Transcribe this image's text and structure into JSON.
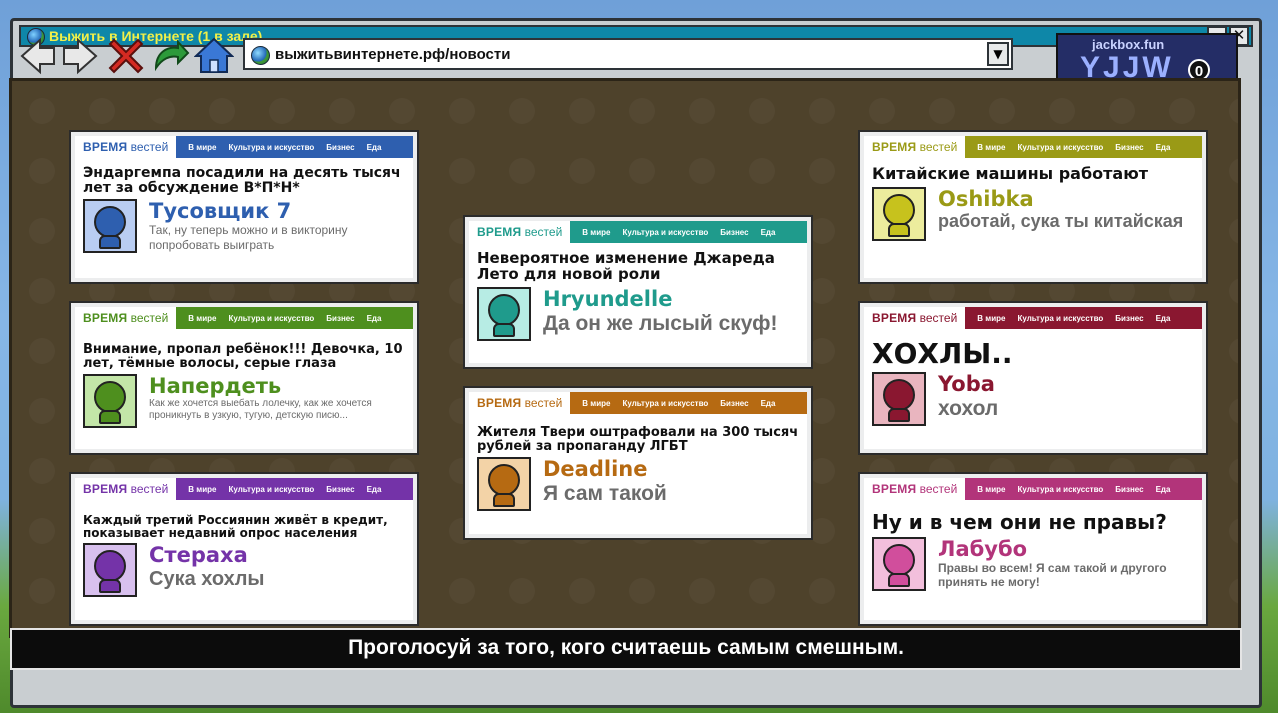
{
  "window": {
    "title": "Выжить в Интернете  (1 в зале)",
    "minimize_label": "_",
    "close_label": "✕"
  },
  "toolbar": {
    "icons": [
      "back-arrow-icon",
      "forward-arrow-icon",
      "stop-x-icon",
      "refresh-arrow-icon",
      "home-icon"
    ]
  },
  "address_bar": {
    "url": "выжитьвинтернете.рф/новости",
    "dropdown_label": "▼"
  },
  "room": {
    "site": "jackbox.fun",
    "code": "YJJW",
    "audience_count": "0"
  },
  "card_nav": {
    "brand_bold": "ВРЕМЯ",
    "brand_rest": " вестей",
    "items": [
      "В мире",
      "Культура и искусство",
      "Бизнес",
      "Еда"
    ]
  },
  "cards": [
    {
      "headline": "Эндаргемпа посадили на десять тысяч лет за обсуждение В*П*Н*",
      "player": "Тусовщик 7",
      "answer": "Так, ну теперь можно и в викторину попробовать выиграть",
      "color": "#2e5faf",
      "tint": "#b9cdf2"
    },
    {
      "headline": "Внимание, пропал ребёнок!!! Девочка, 10 лет, тёмные волосы, серые глаза",
      "player": "Напердеть",
      "answer": "Как же хочется выебать лолечку, как же хочется проникнуть в узкую, тугую, детскую писю...",
      "color": "#4e8f1e",
      "tint": "#c3e6a8"
    },
    {
      "headline": "Каждый третий Россиянин живёт в кредит, показывает недавний опрос населения",
      "player": "Стераха",
      "answer": "Сука хохлы",
      "color": "#7433a8",
      "tint": "#d8c0ee"
    },
    {
      "headline": "Невероятное изменение Джареда Лето для новой роли",
      "player": "Hryundelle",
      "answer": "Да он же лысый скуф!",
      "color": "#1f9b8c",
      "tint": "#b7ece4"
    },
    {
      "headline": "Жителя Твери оштрафовали на 300 тысяч рублей за пропаганду ЛГБТ",
      "player": "Deadline",
      "answer": "Я сам такой",
      "color": "#b66a12",
      "tint": "#f3d3a7"
    },
    {
      "headline": "Китайские машины работают",
      "player": "Oshibka",
      "answer": "работай, сука ты китайская",
      "color": "#9a9a16",
      "tint": "#ecec9d"
    },
    {
      "headline": "ХОХЛЫ..",
      "player": "Yoba",
      "answer": "хохол",
      "color": "#8a1730",
      "tint": "#e9b5bf"
    },
    {
      "headline": "Ну и в чем они не правы?",
      "player": "Лабубо",
      "answer": "Правы во всем! Я сам такой и другого принять не могу!",
      "color": "#b2347a",
      "tint": "#f2bfdc"
    }
  ],
  "prompt": "Проголосуй за того, кого считаешь самым смешным."
}
